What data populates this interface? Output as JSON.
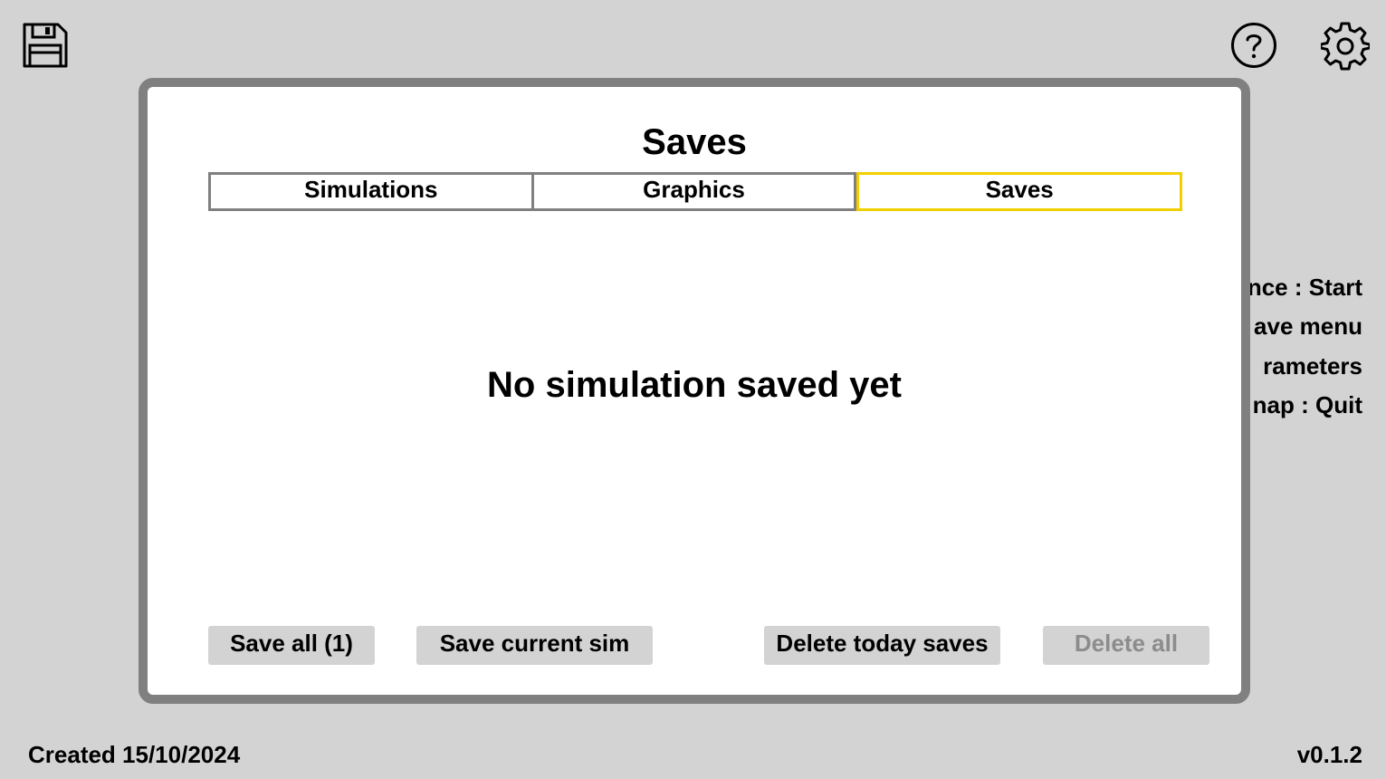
{
  "top_bar": {
    "save_icon": "floppy-disk-icon",
    "help_icon": "question-circle-icon",
    "settings_icon": "gear-icon"
  },
  "background_shortcuts": [
    "nce : Start",
    "ave menu",
    "rameters",
    "nap : Quit"
  ],
  "footer": {
    "created": "Created 15/10/2024",
    "version": "v0.1.2"
  },
  "modal": {
    "title": "Saves",
    "tabs": [
      {
        "label": "Simulations",
        "active": false
      },
      {
        "label": "Graphics",
        "active": false
      },
      {
        "label": "Saves",
        "active": true
      }
    ],
    "empty_message": "No simulation saved yet",
    "buttons": {
      "save_all": "Save all (1)",
      "save_current": "Save current sim",
      "delete_today": "Delete today saves",
      "delete_all": "Delete all"
    }
  },
  "colors": {
    "background": "#d3d3d3",
    "modal_border": "#808080",
    "active_tab_border": "#f2d000",
    "disabled_text": "#8c8c8c"
  }
}
